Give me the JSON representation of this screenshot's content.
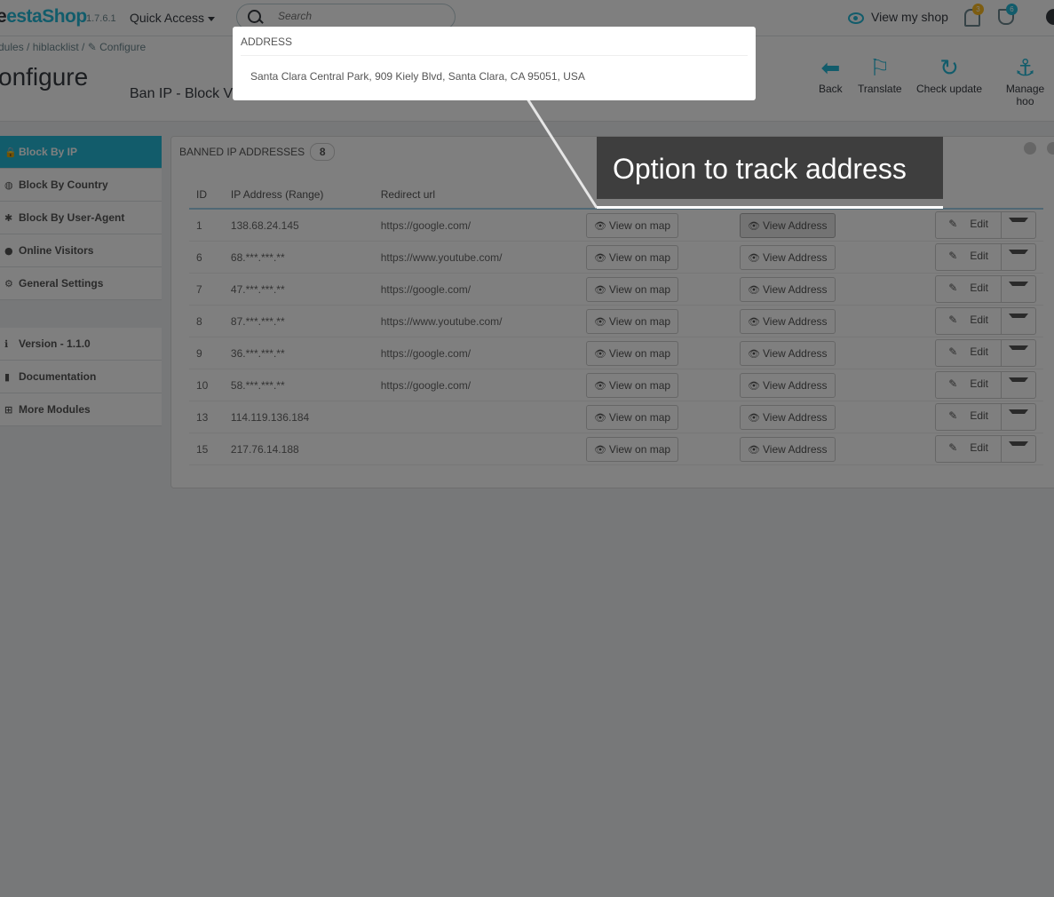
{
  "header": {
    "logo_fragment": "estaShop",
    "logo_prefix_char": "e",
    "version": "1.7.6.1",
    "quick_access": "Quick Access",
    "search_placeholder": "Search",
    "view_shop": "View my shop",
    "notifications_count": "3",
    "orders_count": "6"
  },
  "toolbar": {
    "breadcrumb": "dules  /  hiblacklist  /  ✎ Configure",
    "title": "onfigure",
    "subtitle": "Ban IP - Block Vis",
    "buttons": [
      {
        "label": "Back",
        "icon": "back-arrow-icon"
      },
      {
        "label": "Translate",
        "icon": "flag-icon"
      },
      {
        "label": "Check update",
        "icon": "refresh-icon"
      },
      {
        "label": "Manage hoo",
        "icon": "anchor-icon"
      }
    ]
  },
  "sidebar": {
    "items": [
      {
        "label": "Block By IP",
        "active": true
      },
      {
        "label": "Block By Country"
      },
      {
        "label": "Block By User-Agent"
      },
      {
        "label": "Online Visitors"
      },
      {
        "label": "General Settings"
      }
    ],
    "items2": [
      {
        "label": "Version - 1.1.0"
      },
      {
        "label": "Documentation"
      },
      {
        "label": "More Modules"
      }
    ]
  },
  "panel": {
    "title": "BANNED IP ADDRESSES",
    "count": "8",
    "columns": [
      "ID",
      "IP Address (Range)",
      "Redirect url",
      "",
      "",
      ""
    ],
    "view_map_label": "View on map",
    "view_address_label": "View Address",
    "edit_label": "Edit",
    "rows": [
      {
        "id": "1",
        "ip": "138.68.24.145",
        "url": "https://google.com/"
      },
      {
        "id": "6",
        "ip": "68.***.***.**",
        "url": "https://www.youtube.com/"
      },
      {
        "id": "7",
        "ip": "47.***.***.**",
        "url": "https://google.com/"
      },
      {
        "id": "8",
        "ip": "87.***.***.**",
        "url": "https://www.youtube.com/"
      },
      {
        "id": "9",
        "ip": "36.***.***.**",
        "url": "https://google.com/"
      },
      {
        "id": "10",
        "ip": "58.***.***.**",
        "url": "https://google.com/"
      },
      {
        "id": "13",
        "ip": "114.119.136.184",
        "url": ""
      },
      {
        "id": "15",
        "ip": "217.76.14.188",
        "url": ""
      }
    ]
  },
  "popover": {
    "title": "ADDRESS",
    "text": "Santa Clara Central Park, 909 Kiely Blvd, Santa Clara, CA 95051, USA"
  },
  "callout": {
    "text": "Option to track address"
  },
  "colors": {
    "accent": "#25b9d7",
    "callout_bg": "#3e3e3e"
  }
}
